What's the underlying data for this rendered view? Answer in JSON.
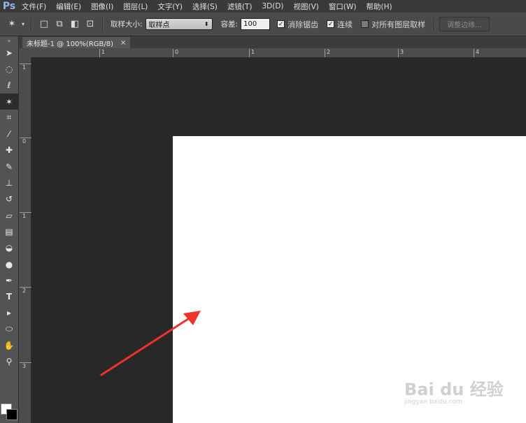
{
  "app": {
    "logo": "Ps"
  },
  "menu": [
    "文件(F)",
    "编辑(E)",
    "图像(I)",
    "图层(L)",
    "文字(Y)",
    "选择(S)",
    "滤镜(T)",
    "3D(D)",
    "视图(V)",
    "窗口(W)",
    "帮助(H)"
  ],
  "options": {
    "sample_size_label": "取样大小:",
    "sample_size_value": "取样点",
    "tolerance_label": "容差:",
    "tolerance_value": "100",
    "antialias_label": "消除锯齿",
    "contiguous_label": "连续",
    "sample_all_label": "对所有图层取样",
    "refine_edge_label": "调整边缘..."
  },
  "document": {
    "tab_title": "未标题-1 @ 100%(RGB/8)",
    "close_glyph": "×"
  },
  "ruler": {
    "top_ticks": [
      "1",
      "0",
      "1",
      "2",
      "3",
      "4"
    ],
    "left_ticks": [
      "1",
      "0",
      "1",
      "2",
      "3"
    ]
  },
  "watermark": {
    "main": "Bai du 经验",
    "sub": "jingyan.baidu.com"
  },
  "colors": {
    "foreground": "#ffffff",
    "background": "#000000",
    "arrow": "#f0322a"
  }
}
